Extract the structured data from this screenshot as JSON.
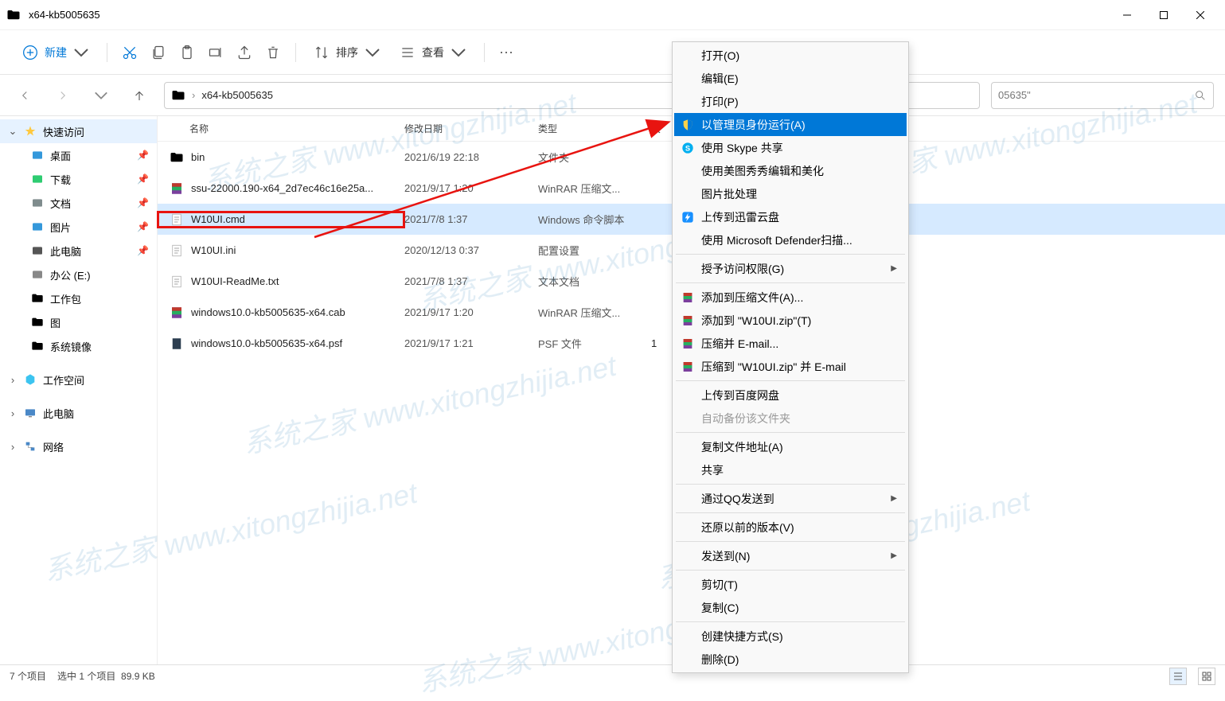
{
  "window": {
    "title": "x64-kb5005635"
  },
  "toolbar": {
    "new": "新建",
    "sort": "排序",
    "view": "查看"
  },
  "path": {
    "current": "x64-kb5005635",
    "search_suffix": "05635\""
  },
  "sidebar": {
    "quick_access": "快速访问",
    "items": [
      {
        "label": "桌面",
        "pinned": true,
        "color": "#3498db"
      },
      {
        "label": "下载",
        "pinned": true,
        "color": "#2ecc71"
      },
      {
        "label": "文档",
        "pinned": true,
        "color": "#7f8c8d"
      },
      {
        "label": "图片",
        "pinned": true,
        "color": "#3498db"
      },
      {
        "label": "此电脑",
        "pinned": true,
        "color": "#555"
      },
      {
        "label": "办公 (E:)",
        "pinned": false,
        "color": "#888"
      },
      {
        "label": "工作包",
        "pinned": false,
        "color": "#ffd86b"
      },
      {
        "label": "图",
        "pinned": false,
        "color": "#ffd86b"
      },
      {
        "label": "系统镜像",
        "pinned": false,
        "color": "#ffd86b"
      }
    ],
    "workspace": "工作空间",
    "this_pc": "此电脑",
    "network": "网络"
  },
  "columns": {
    "name": "名称",
    "date": "修改日期",
    "type": "类型",
    "size": "大"
  },
  "files": [
    {
      "name": "bin",
      "date": "2021/6/19 22:18",
      "type": "文件夹",
      "icon": "folder"
    },
    {
      "name": "ssu-22000.190-x64_2d7ec46c16e25a...",
      "date": "2021/9/17 1:20",
      "type": "WinRAR 压缩文...",
      "icon": "rar"
    },
    {
      "name": "W10UI.cmd",
      "date": "2021/7/8 1:37",
      "type": "Windows 命令脚本",
      "icon": "cmd",
      "selected": true,
      "highlighted": true
    },
    {
      "name": "W10UI.ini",
      "date": "2020/12/13 0:37",
      "type": "配置设置",
      "icon": "ini"
    },
    {
      "name": "W10UI-ReadMe.txt",
      "date": "2021/7/8 1:37",
      "type": "文本文档",
      "icon": "txt"
    },
    {
      "name": "windows10.0-kb5005635-x64.cab",
      "date": "2021/9/17 1:20",
      "type": "WinRAR 压缩文...",
      "icon": "rar"
    },
    {
      "name": "windows10.0-kb5005635-x64.psf",
      "date": "2021/9/17 1:21",
      "type": "PSF 文件",
      "icon": "psf",
      "size": "1"
    }
  ],
  "context_menu": [
    {
      "type": "item",
      "label": "打开(O)"
    },
    {
      "type": "item",
      "label": "编辑(E)"
    },
    {
      "type": "item",
      "label": "打印(P)"
    },
    {
      "type": "item",
      "label": "以管理员身份运行(A)",
      "icon": "shield",
      "highlighted": true
    },
    {
      "type": "item",
      "label": "使用 Skype 共享",
      "icon": "skype"
    },
    {
      "type": "item",
      "label": "使用美图秀秀编辑和美化"
    },
    {
      "type": "item",
      "label": "图片批处理"
    },
    {
      "type": "item",
      "label": "上传到迅雷云盘",
      "icon": "xunlei"
    },
    {
      "type": "item",
      "label": "使用 Microsoft Defender扫描..."
    },
    {
      "type": "sep"
    },
    {
      "type": "item",
      "label": "授予访问权限(G)",
      "submenu": true
    },
    {
      "type": "sep"
    },
    {
      "type": "item",
      "label": "添加到压缩文件(A)...",
      "icon": "rar"
    },
    {
      "type": "item",
      "label": "添加到 \"W10UI.zip\"(T)",
      "icon": "rar"
    },
    {
      "type": "item",
      "label": "压缩并 E-mail...",
      "icon": "rar"
    },
    {
      "type": "item",
      "label": "压缩到 \"W10UI.zip\" 并 E-mail",
      "icon": "rar"
    },
    {
      "type": "sep"
    },
    {
      "type": "item",
      "label": "上传到百度网盘"
    },
    {
      "type": "item",
      "label": "自动备份该文件夹",
      "disabled": true
    },
    {
      "type": "sep"
    },
    {
      "type": "item",
      "label": "复制文件地址(A)"
    },
    {
      "type": "item",
      "label": "共享"
    },
    {
      "type": "sep"
    },
    {
      "type": "item",
      "label": "通过QQ发送到",
      "submenu": true
    },
    {
      "type": "sep"
    },
    {
      "type": "item",
      "label": "还原以前的版本(V)"
    },
    {
      "type": "sep"
    },
    {
      "type": "item",
      "label": "发送到(N)",
      "submenu": true
    },
    {
      "type": "sep"
    },
    {
      "type": "item",
      "label": "剪切(T)"
    },
    {
      "type": "item",
      "label": "复制(C)"
    },
    {
      "type": "sep"
    },
    {
      "type": "item",
      "label": "创建快捷方式(S)"
    },
    {
      "type": "item",
      "label": "删除(D)"
    }
  ],
  "statusbar": {
    "count": "7 个项目",
    "selection": "选中 1 个项目",
    "size": "89.9 KB"
  },
  "watermark": "系统之家 www.xitongzhijia.net"
}
